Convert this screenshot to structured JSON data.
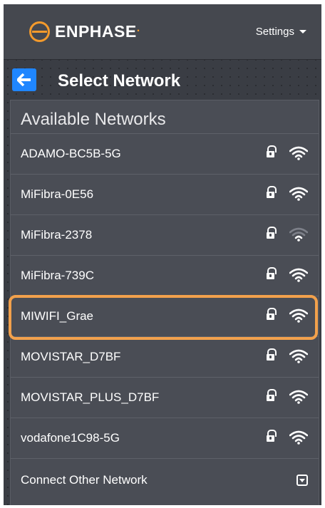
{
  "header": {
    "brand": "ENPHASE",
    "brand_suffix": ".",
    "settings_label": "Settings"
  },
  "page": {
    "title": "Select Network"
  },
  "networks_panel": {
    "title": "Available Networks",
    "networks": [
      {
        "ssid": "ADAMO-BC5B-5G",
        "secured": true,
        "signal": "strong"
      },
      {
        "ssid": "MiFibra-0E56",
        "secured": true,
        "signal": "strong"
      },
      {
        "ssid": "MiFibra-2378",
        "secured": true,
        "signal": "weak"
      },
      {
        "ssid": "MiFibra-739C",
        "secured": true,
        "signal": "strong"
      },
      {
        "ssid": "MIWIFI_Grae",
        "secured": true,
        "signal": "strong",
        "highlighted": true
      },
      {
        "ssid": "MOVISTAR_D7BF",
        "secured": true,
        "signal": "strong"
      },
      {
        "ssid": "MOVISTAR_PLUS_D7BF",
        "secured": true,
        "signal": "strong"
      },
      {
        "ssid": "vodafone1C98-5G",
        "secured": true,
        "signal": "strong"
      }
    ],
    "other_network_label": "Connect Other Network"
  },
  "icons": {
    "logo": "enphase-logo-icon",
    "back": "arrow-left-icon",
    "lock": "lock-icon",
    "wifi": "wifi-icon",
    "dropdown": "chevron-down-box-icon"
  },
  "colors": {
    "accent_orange": "#f39a2c",
    "back_button_blue": "#1f86ff",
    "highlight_outline": "#f2a14c"
  }
}
